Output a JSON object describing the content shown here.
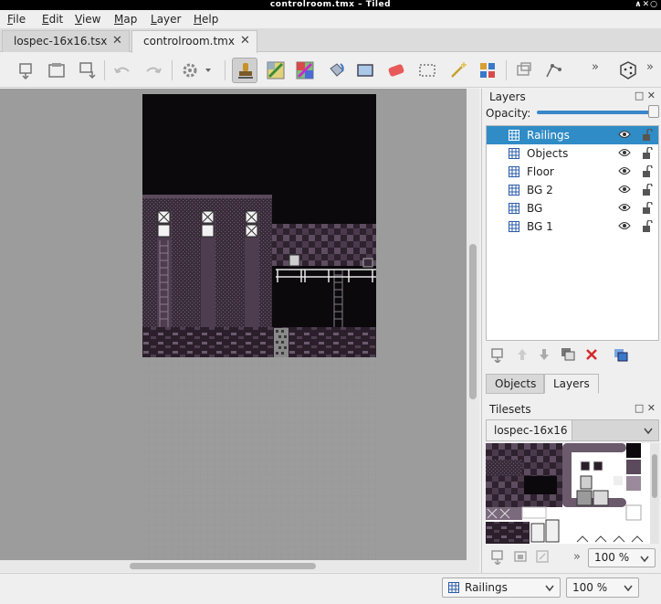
{
  "window": {
    "title": "controlroom.tmx – Tiled",
    "controls": "∧✕○"
  },
  "menu": [
    {
      "pre": "",
      "mn": "F",
      "post": "ile"
    },
    {
      "pre": "",
      "mn": "E",
      "post": "dit"
    },
    {
      "pre": "",
      "mn": "V",
      "post": "iew"
    },
    {
      "pre": "",
      "mn": "M",
      "post": "ap"
    },
    {
      "pre": "",
      "mn": "L",
      "post": "ayer"
    },
    {
      "pre": "",
      "mn": "H",
      "post": "elp"
    }
  ],
  "tabs": [
    {
      "label": "lospec-16x16.tsx",
      "active": false
    },
    {
      "label": "controlroom.tmx",
      "active": true
    }
  ],
  "close_glyph": "✕",
  "toolbar": {
    "tools": [
      "new-map-icon",
      "open-icon",
      "save-icon",
      "undo-icon",
      "redo-icon",
      "commands-icon",
      "stamp-brush-icon",
      "terrain-brush-icon",
      "wang-brush-icon",
      "bucket-fill-icon",
      "shape-fill-icon",
      "eraser-icon",
      "rect-select-icon",
      "magic-wand-icon",
      "select-same-tile-icon",
      "move-icon",
      "edit-polygons-icon",
      "random-mode-icon"
    ],
    "selected_tool": "stamp-brush-icon",
    "more": "»"
  },
  "layers_panel": {
    "title": "Layers",
    "opacity_label": "Opacity:",
    "opacity": 1.0,
    "layers": [
      {
        "name": "Railings",
        "selected": true
      },
      {
        "name": "Objects",
        "selected": false
      },
      {
        "name": "Floor",
        "selected": false
      },
      {
        "name": "BG 2",
        "selected": false
      },
      {
        "name": "BG",
        "selected": false
      },
      {
        "name": "BG 1",
        "selected": false
      }
    ],
    "tools": [
      "new-layer-icon",
      "raise-layer-icon",
      "lower-layer-icon",
      "duplicate-layer-icon",
      "remove-layer-icon",
      "show-other-layers-icon"
    ]
  },
  "panel_tabs": [
    {
      "label": "Objects",
      "active": false
    },
    {
      "label": "Layers",
      "active": true
    }
  ],
  "tilesets_panel": {
    "title": "Tilesets",
    "active_tileset": "lospec-16x16",
    "zoom": "100 %",
    "more": "»"
  },
  "status": {
    "layer": "Railings",
    "zoom": "100 %"
  },
  "colors": {
    "selection": "#308cc6",
    "map_bg": "#0b090b",
    "wall": "#3c2e3e",
    "wall_light": "#5a4a5c",
    "canvas_bg": "#9c9c9c"
  }
}
